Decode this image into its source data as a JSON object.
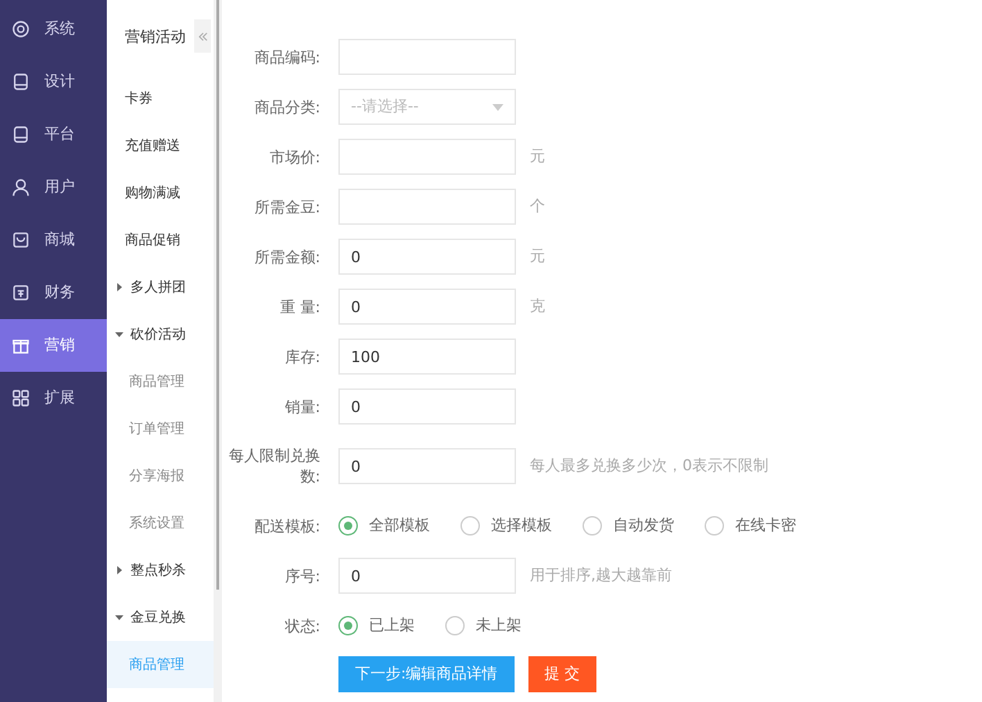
{
  "nav": [
    {
      "label": "系统",
      "selected": false
    },
    {
      "label": "设计",
      "selected": false
    },
    {
      "label": "平台",
      "selected": false
    },
    {
      "label": "用户",
      "selected": false
    },
    {
      "label": "商城",
      "selected": false
    },
    {
      "label": "财务",
      "selected": false
    },
    {
      "label": "营销",
      "selected": true
    },
    {
      "label": "扩展",
      "selected": false
    }
  ],
  "submenu": {
    "title": "营销活动",
    "items": [
      {
        "kind": "item",
        "label": "卡券",
        "selected": false
      },
      {
        "kind": "item",
        "label": "充值赠送",
        "selected": false
      },
      {
        "kind": "item",
        "label": "购物满减",
        "selected": false
      },
      {
        "kind": "item",
        "label": "商品促销",
        "selected": false
      },
      {
        "kind": "group",
        "label": "多人拼团",
        "expanded": false
      },
      {
        "kind": "group",
        "label": "砍价活动",
        "expanded": true,
        "children": [
          {
            "label": "商品管理",
            "selected": false
          },
          {
            "label": "订单管理",
            "selected": false
          },
          {
            "label": "分享海报",
            "selected": false
          },
          {
            "label": "系统设置",
            "selected": false
          }
        ]
      },
      {
        "kind": "group",
        "label": "整点秒杀",
        "expanded": false
      },
      {
        "kind": "group",
        "label": "金豆兑换",
        "expanded": true,
        "children": [
          {
            "label": "商品管理",
            "selected": true
          }
        ]
      }
    ]
  },
  "form": {
    "fields": [
      {
        "kind": "input",
        "label": "商品编码:"
      },
      {
        "kind": "select",
        "label": "商品分类:",
        "placeholder": "--请选择--"
      },
      {
        "kind": "input",
        "label": "市场价:",
        "suffix": "元"
      },
      {
        "kind": "input",
        "label": "所需金豆:",
        "suffix": "个"
      },
      {
        "kind": "input",
        "label": "所需金额:",
        "value": "0",
        "suffix": "元"
      },
      {
        "kind": "input",
        "label": "重 量:",
        "value": "0",
        "suffix": "克"
      },
      {
        "kind": "input",
        "label": "库存:",
        "value": "100"
      },
      {
        "kind": "input",
        "label": "销量:",
        "value": "0"
      },
      {
        "kind": "input",
        "label": "每人限制兑换数:",
        "value": "0",
        "suffix": "每人最多兑换多少次，0表示不限制"
      },
      {
        "kind": "radio",
        "label": "配送模板:",
        "options": [
          {
            "label": "全部模板",
            "selected": true
          },
          {
            "label": "选择模板",
            "selected": false
          },
          {
            "label": "自动发货",
            "selected": false
          },
          {
            "label": "在线卡密",
            "selected": false
          }
        ]
      },
      {
        "kind": "input",
        "label": "序号:",
        "value": "0",
        "suffix": "用于排序,越大越靠前"
      },
      {
        "kind": "radio",
        "label": "状态:",
        "options": [
          {
            "label": "已上架",
            "selected": true
          },
          {
            "label": "未上架",
            "selected": false
          }
        ]
      }
    ],
    "buttons": [
      {
        "kind": "primary",
        "label": "下一步:编辑商品详情"
      },
      {
        "kind": "danger",
        "label": "提 交"
      }
    ]
  }
}
